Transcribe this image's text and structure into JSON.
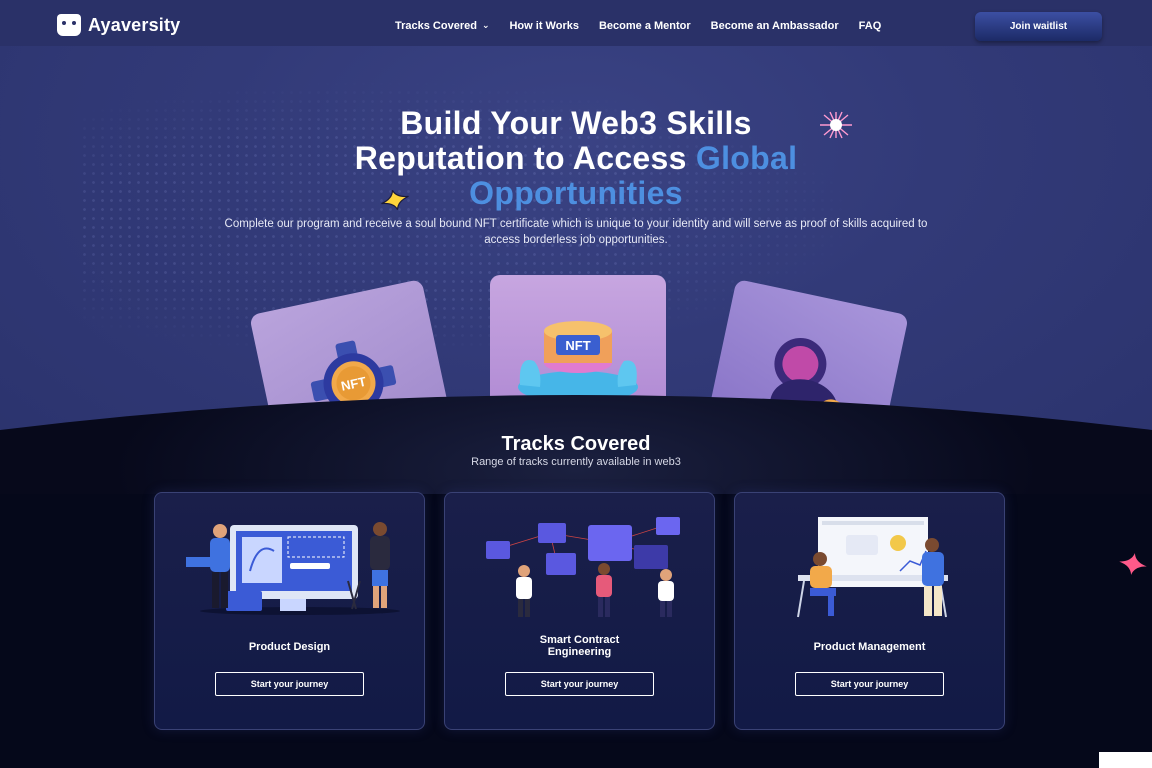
{
  "brand": {
    "name": "Ayaversity"
  },
  "nav": {
    "links": [
      "Tracks Covered",
      "How it Works",
      "Become a Mentor",
      "Become an Ambassador",
      "FAQ"
    ],
    "join_label": "Join waitlist"
  },
  "hero": {
    "line1": "Build Your Web3 Skills",
    "line2_plain": "Reputation to Access ",
    "line2_accent": "Global",
    "line3_accent": "Opportunities",
    "subtitle": "Complete our program and receive a soul bound NFT certificate which is unique to your identity and will serve as proof of skills acquired to access borderless job opportunities.",
    "card_labels": [
      "NFT",
      "NFT"
    ]
  },
  "tracks": {
    "title": "Tracks Covered",
    "subtitle": "Range of tracks currently available in web3",
    "items": [
      {
        "name": "Product Design",
        "button": "Start your journey"
      },
      {
        "name_line1": "Smart Contract",
        "name_line2": "Engineering",
        "button": "Start your journey"
      },
      {
        "name": "Product Management",
        "button": "Start your journey"
      }
    ]
  },
  "colors": {
    "hero_bg": "#323a78",
    "nav_bg": "#2a3168",
    "accent_blue": "#4d8fe0",
    "dark_bg": "#07091b",
    "card_bg": "#151c48",
    "sparkle_pink": "#ff5a8a",
    "sparkle_yellow": "#ffd43b"
  }
}
